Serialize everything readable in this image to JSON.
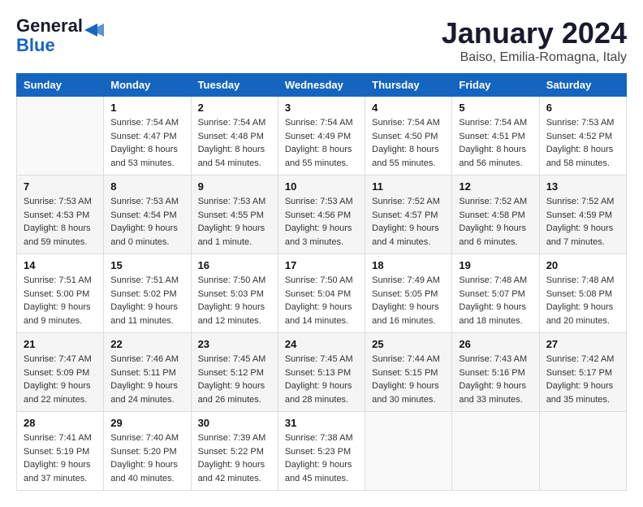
{
  "header": {
    "logo_line1": "General",
    "logo_line2": "Blue",
    "month": "January 2024",
    "location": "Baiso, Emilia-Romagna, Italy"
  },
  "columns": [
    "Sunday",
    "Monday",
    "Tuesday",
    "Wednesday",
    "Thursday",
    "Friday",
    "Saturday"
  ],
  "weeks": [
    [
      {
        "day": "",
        "detail": ""
      },
      {
        "day": "1",
        "detail": "Sunrise: 7:54 AM\nSunset: 4:47 PM\nDaylight: 8 hours\nand 53 minutes."
      },
      {
        "day": "2",
        "detail": "Sunrise: 7:54 AM\nSunset: 4:48 PM\nDaylight: 8 hours\nand 54 minutes."
      },
      {
        "day": "3",
        "detail": "Sunrise: 7:54 AM\nSunset: 4:49 PM\nDaylight: 8 hours\nand 55 minutes."
      },
      {
        "day": "4",
        "detail": "Sunrise: 7:54 AM\nSunset: 4:50 PM\nDaylight: 8 hours\nand 55 minutes."
      },
      {
        "day": "5",
        "detail": "Sunrise: 7:54 AM\nSunset: 4:51 PM\nDaylight: 8 hours\nand 56 minutes."
      },
      {
        "day": "6",
        "detail": "Sunrise: 7:53 AM\nSunset: 4:52 PM\nDaylight: 8 hours\nand 58 minutes."
      }
    ],
    [
      {
        "day": "7",
        "detail": "Sunrise: 7:53 AM\nSunset: 4:53 PM\nDaylight: 8 hours\nand 59 minutes."
      },
      {
        "day": "8",
        "detail": "Sunrise: 7:53 AM\nSunset: 4:54 PM\nDaylight: 9 hours\nand 0 minutes."
      },
      {
        "day": "9",
        "detail": "Sunrise: 7:53 AM\nSunset: 4:55 PM\nDaylight: 9 hours\nand 1 minute."
      },
      {
        "day": "10",
        "detail": "Sunrise: 7:53 AM\nSunset: 4:56 PM\nDaylight: 9 hours\nand 3 minutes."
      },
      {
        "day": "11",
        "detail": "Sunrise: 7:52 AM\nSunset: 4:57 PM\nDaylight: 9 hours\nand 4 minutes."
      },
      {
        "day": "12",
        "detail": "Sunrise: 7:52 AM\nSunset: 4:58 PM\nDaylight: 9 hours\nand 6 minutes."
      },
      {
        "day": "13",
        "detail": "Sunrise: 7:52 AM\nSunset: 4:59 PM\nDaylight: 9 hours\nand 7 minutes."
      }
    ],
    [
      {
        "day": "14",
        "detail": "Sunrise: 7:51 AM\nSunset: 5:00 PM\nDaylight: 9 hours\nand 9 minutes."
      },
      {
        "day": "15",
        "detail": "Sunrise: 7:51 AM\nSunset: 5:02 PM\nDaylight: 9 hours\nand 11 minutes."
      },
      {
        "day": "16",
        "detail": "Sunrise: 7:50 AM\nSunset: 5:03 PM\nDaylight: 9 hours\nand 12 minutes."
      },
      {
        "day": "17",
        "detail": "Sunrise: 7:50 AM\nSunset: 5:04 PM\nDaylight: 9 hours\nand 14 minutes."
      },
      {
        "day": "18",
        "detail": "Sunrise: 7:49 AM\nSunset: 5:05 PM\nDaylight: 9 hours\nand 16 minutes."
      },
      {
        "day": "19",
        "detail": "Sunrise: 7:48 AM\nSunset: 5:07 PM\nDaylight: 9 hours\nand 18 minutes."
      },
      {
        "day": "20",
        "detail": "Sunrise: 7:48 AM\nSunset: 5:08 PM\nDaylight: 9 hours\nand 20 minutes."
      }
    ],
    [
      {
        "day": "21",
        "detail": "Sunrise: 7:47 AM\nSunset: 5:09 PM\nDaylight: 9 hours\nand 22 minutes."
      },
      {
        "day": "22",
        "detail": "Sunrise: 7:46 AM\nSunset: 5:11 PM\nDaylight: 9 hours\nand 24 minutes."
      },
      {
        "day": "23",
        "detail": "Sunrise: 7:45 AM\nSunset: 5:12 PM\nDaylight: 9 hours\nand 26 minutes."
      },
      {
        "day": "24",
        "detail": "Sunrise: 7:45 AM\nSunset: 5:13 PM\nDaylight: 9 hours\nand 28 minutes."
      },
      {
        "day": "25",
        "detail": "Sunrise: 7:44 AM\nSunset: 5:15 PM\nDaylight: 9 hours\nand 30 minutes."
      },
      {
        "day": "26",
        "detail": "Sunrise: 7:43 AM\nSunset: 5:16 PM\nDaylight: 9 hours\nand 33 minutes."
      },
      {
        "day": "27",
        "detail": "Sunrise: 7:42 AM\nSunset: 5:17 PM\nDaylight: 9 hours\nand 35 minutes."
      }
    ],
    [
      {
        "day": "28",
        "detail": "Sunrise: 7:41 AM\nSunset: 5:19 PM\nDaylight: 9 hours\nand 37 minutes."
      },
      {
        "day": "29",
        "detail": "Sunrise: 7:40 AM\nSunset: 5:20 PM\nDaylight: 9 hours\nand 40 minutes."
      },
      {
        "day": "30",
        "detail": "Sunrise: 7:39 AM\nSunset: 5:22 PM\nDaylight: 9 hours\nand 42 minutes."
      },
      {
        "day": "31",
        "detail": "Sunrise: 7:38 AM\nSunset: 5:23 PM\nDaylight: 9 hours\nand 45 minutes."
      },
      {
        "day": "",
        "detail": ""
      },
      {
        "day": "",
        "detail": ""
      },
      {
        "day": "",
        "detail": ""
      }
    ]
  ]
}
